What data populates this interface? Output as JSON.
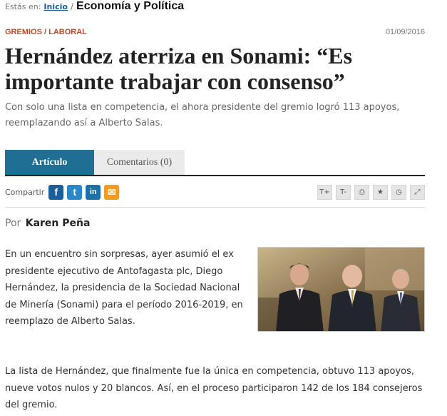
{
  "breadcrumb": {
    "prefix": "Estás en:",
    "home": "Inicio",
    "separator": "/",
    "section": "Economía y Política"
  },
  "article": {
    "category": "GREMIOS / LABORAL",
    "date": "01/09/2016",
    "title": "Hernández aterriza en Sonami: “Es importante trabajar con consenso”",
    "subtitle": "Con solo una lista en competencia, el ahora presidente del gremio logró 113 apoyos, reemplazando así a Alberto Salas.",
    "byline_prefix": "Por",
    "author": "Karen Peña",
    "paragraph1": "En un encuentro sin sorpresas, ayer asumió el ex presidente ejecutivo de Antofagasta plc, Diego Hernández, la presidencia de la Sociedad Nacional de Minería (Sonami) para el período 2016-2019, en reemplazo de Alberto Salas.",
    "paragraph2": "La lista de Hernández, que finalmente fue la única en competencia, obtuvo 113 apoyos, nueve votos nulos y 20 blancos. Así, en el proceso participaron 142 de los 184 consejeros del gremio."
  },
  "tabs": {
    "article": "Artículo",
    "comments": "Comentarios (0)"
  },
  "share": {
    "label": "Compartir",
    "facebook_glyph": "f",
    "twitter_glyph": "t",
    "linkedin_glyph": "in",
    "email_glyph": "✉"
  },
  "tools": {
    "text_larger_glyph": "T+",
    "text_smaller_glyph": "T-",
    "print_glyph": "⎙",
    "favorite_glyph": "★",
    "clock_glyph": "◷",
    "fullscreen_glyph": "⤢"
  },
  "colors": {
    "category": "#b84a2a",
    "tab_active": "#1f6f93",
    "facebook": "#1a5f9b",
    "twitter": "#2b88c8",
    "linkedin": "#1d70a8",
    "email": "#f39a21"
  }
}
